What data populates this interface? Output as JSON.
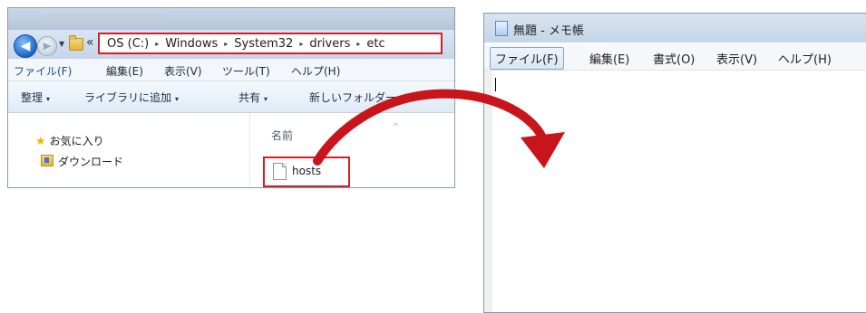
{
  "explorer": {
    "address": {
      "overflow_glyph": "«",
      "crumbs": [
        "OS (C:)",
        "Windows",
        "System32",
        "drivers",
        "etc"
      ],
      "separator_glyph": "▸"
    },
    "menu": [
      "ファイル(F)",
      "編集(E)",
      "表示(V)",
      "ツール(T)",
      "ヘルプ(H)"
    ],
    "toolbar": {
      "organize": "整理",
      "add_to_library": "ライブラリに追加",
      "share": "共有",
      "new_folder": "新しいフォルダー",
      "caret": "▾"
    },
    "nav": {
      "favorites": "お気に入り",
      "downloads": "ダウンロード"
    },
    "list": {
      "column_name": "名前",
      "sort_caret": "^",
      "file": "hosts"
    }
  },
  "notepad": {
    "title": "無題 - メモ帳",
    "menu": [
      "ファイル(F)",
      "編集(E)",
      "書式(O)",
      "表示(V)",
      "ヘルプ(H)"
    ]
  },
  "colors": {
    "highlight_red": "#d41d24",
    "arrow_red": "#c8141b"
  }
}
